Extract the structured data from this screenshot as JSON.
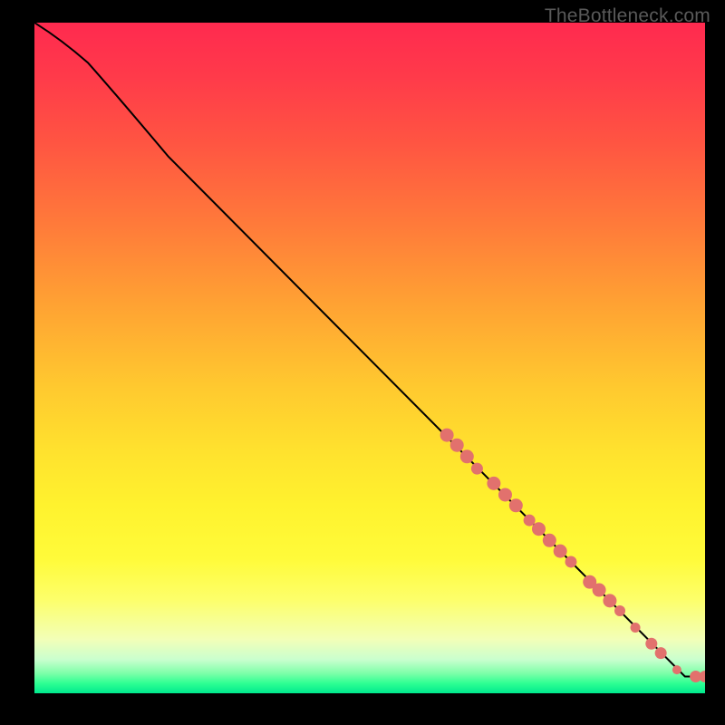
{
  "attribution": "TheBottleneck.com",
  "chart_data": {
    "type": "line",
    "title": "",
    "xlabel": "",
    "ylabel": "",
    "xlim": [
      0,
      100
    ],
    "ylim": [
      0,
      100
    ],
    "curve": [
      {
        "x": 0,
        "y": 100
      },
      {
        "x": 4,
        "y": 97.5
      },
      {
        "x": 8,
        "y": 94
      },
      {
        "x": 12,
        "y": 89.5
      },
      {
        "x": 20,
        "y": 80
      },
      {
        "x": 97,
        "y": 2.5
      },
      {
        "x": 100,
        "y": 2.5
      }
    ],
    "points": [
      {
        "x": 61.5,
        "y": 38.5,
        "r": 7.5
      },
      {
        "x": 63.0,
        "y": 37.0,
        "r": 7.5
      },
      {
        "x": 64.5,
        "y": 35.3,
        "r": 7.5
      },
      {
        "x": 66.0,
        "y": 33.5,
        "r": 6.5
      },
      {
        "x": 68.5,
        "y": 31.3,
        "r": 7.5
      },
      {
        "x": 70.2,
        "y": 29.6,
        "r": 7.5
      },
      {
        "x": 71.8,
        "y": 28.0,
        "r": 7.5
      },
      {
        "x": 73.8,
        "y": 25.8,
        "r": 6.5
      },
      {
        "x": 75.2,
        "y": 24.5,
        "r": 7.5
      },
      {
        "x": 76.8,
        "y": 22.8,
        "r": 7.5
      },
      {
        "x": 78.4,
        "y": 21.2,
        "r": 7.5
      },
      {
        "x": 80.0,
        "y": 19.6,
        "r": 6.5
      },
      {
        "x": 82.8,
        "y": 16.6,
        "r": 7.5
      },
      {
        "x": 84.2,
        "y": 15.4,
        "r": 7.5
      },
      {
        "x": 85.8,
        "y": 13.8,
        "r": 7.5
      },
      {
        "x": 87.3,
        "y": 12.3,
        "r": 6.0
      },
      {
        "x": 89.6,
        "y": 9.8,
        "r": 5.5
      },
      {
        "x": 92.0,
        "y": 7.4,
        "r": 6.5
      },
      {
        "x": 93.4,
        "y": 6.0,
        "r": 6.5
      },
      {
        "x": 95.8,
        "y": 3.5,
        "r": 5.0
      },
      {
        "x": 98.6,
        "y": 2.5,
        "r": 6.5
      },
      {
        "x": 100.0,
        "y": 2.5,
        "r": 6.5
      }
    ]
  }
}
